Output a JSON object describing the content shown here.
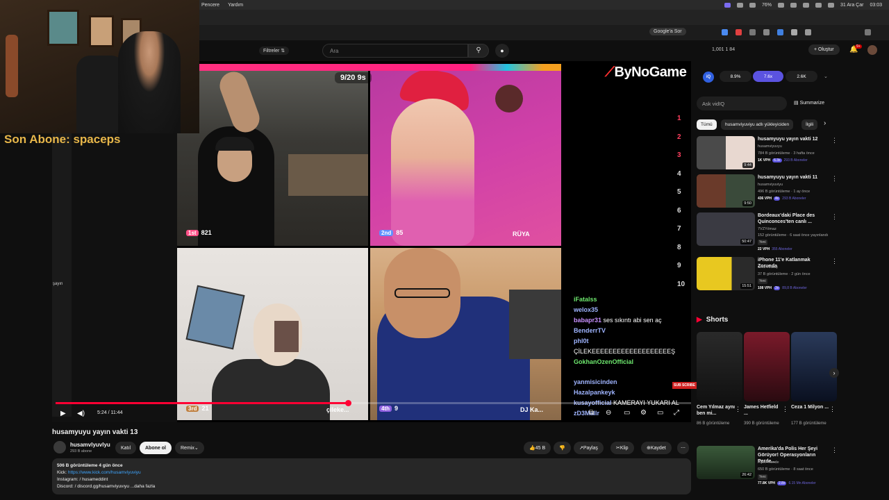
{
  "menubar": {
    "menus": [
      "Pencere",
      "Yardım"
    ],
    "battery": "76%",
    "date": "31 Ara Çar",
    "time": "03:03"
  },
  "browser": {
    "google_sor": "Google'a Sor"
  },
  "stream_overlay": {
    "last_sub": "Son Abone: spaceps"
  },
  "header": {
    "filters": "Filtreler",
    "search_placeholder": "Ara",
    "stats": "1,001  1  84",
    "create": "Oluştur",
    "notif_badge": "9+"
  },
  "player": {
    "timer": "9/20  9s",
    "brand": "ByNoGame",
    "cells": [
      {
        "rank": "1st",
        "score": "821",
        "name": ""
      },
      {
        "rank": "2nd",
        "score": "85",
        "name": "RÜYA"
      },
      {
        "rank": "3rd",
        "score": "21",
        "name": "çileke..."
      },
      {
        "rank": "4th",
        "score": "9",
        "name": "DJ Ka..."
      }
    ],
    "leaderboard": [
      "1",
      "2",
      "3",
      "4",
      "5",
      "6",
      "7",
      "8",
      "9",
      "10"
    ],
    "time": "5:24 / 11:44",
    "progress": 0.46,
    "side_text": "şayın"
  },
  "chat": [
    {
      "user": "iFatalss",
      "msg": ""
    },
    {
      "user": "welox35",
      "msg": ""
    },
    {
      "user": "babapr31",
      "msg": "ses sıkıntı abi sen aç"
    },
    {
      "user": "BenderrTV",
      "msg": ""
    },
    {
      "user": "phl0t",
      "msg": "ÇİLEKEEEEEEEEEEEEEEEEEEEŞ"
    },
    {
      "user": "GokhanOzenOfficial",
      "msg": ""
    },
    {
      "user": "yanmisicinden",
      "msg": ""
    },
    {
      "user": "Hazalpankeyk",
      "msg": ""
    },
    {
      "user": "kusayofficial",
      "msg": "KAMERAYI YUKARI AL"
    },
    {
      "user": "zD3Mallr",
      "msg": ""
    }
  ],
  "chat_badge": "SUB SCRIBE",
  "video": {
    "title": "husamyuyu yayın vakti 13",
    "channel": "husamvlyuvlyu",
    "subs": "293 B abone",
    "join": "Katıl",
    "subscribe": "Abone ol",
    "remix": "Remix",
    "likes": "45 B",
    "share": "Paylaş",
    "clip": "Klip",
    "save": "Kaydet",
    "desc_meta": "506 B görüntüleme  4 gün önce",
    "desc_kick_label": "Kick:",
    "desc_kick_link": "https://www.kick.com/husamviyuviyu",
    "desc_instagram": "Instagram:   / husameddint",
    "desc_discord": "Discord:   / discord.gg/husamviyuvıyu  ...daha fazla"
  },
  "sidebar": {
    "iq_vals": [
      "8.9%",
      "7.6x",
      "2.6K"
    ],
    "iq_label": "iQ",
    "ask": "Ask vidIQ",
    "summarize": "Summarize",
    "chips": [
      "Tümü",
      "husamviyuviyu adlı yükleyiciden",
      "İlgili"
    ],
    "recs": [
      {
        "title": "husamyuyu yayın vakti 12",
        "channel": "husamviyuvyu",
        "views": "784 B görüntüleme · 3 hafta önce",
        "vph": "1K VPH",
        "mult": "6.3x",
        "abo": "293 B Aboneler",
        "dur": "9:44",
        "new": ""
      },
      {
        "title": "husamyuyu yayın vakti 11",
        "channel": "husamviyuviyu",
        "views": "496 B görüntüleme · 1 ay önce",
        "vph": "436 VPH",
        "mult": "4x",
        "abo": "293 B Aboneler",
        "dur": "9:50",
        "new": ""
      },
      {
        "title": "Bordeaux'daki Place des Quinconces'ten canlı ...",
        "channel": "7VZYılmaz",
        "views": "152 görüntüleme · 6 saat önce yayınlandı",
        "vph": "22 VPH",
        "mult": "",
        "abo": "355 Aboneler",
        "dur": "50:47",
        "new": "Yeni"
      },
      {
        "title": "iPhone 11'e Katlanmak Zorunda",
        "channel": "Onur Akbaş",
        "views": "37 B görüntüleme · 2 gün önce",
        "vph": "108 VPH",
        "mult": "3x",
        "abo": "89,8 B Aboneler",
        "dur": "15:51",
        "new": "Yeni"
      }
    ],
    "shorts_title": "Shorts",
    "shorts": [
      {
        "title": "Cem Yılmaz aynı ben mi...",
        "views": "86 B görüntüleme"
      },
      {
        "title": "James Hetfield ...",
        "views": "390 B görüntüleme"
      },
      {
        "title": "Ceza 1 Milyon ...",
        "views": "177 B görüntüleme"
      }
    ],
    "bottom_rec": {
      "title": "Amerika'da Polis Her Şeyi Görüyor! Operasyonların Perde...",
      "channel": "Alper Rende",
      "views": "650 B görüntüleme · 8 saat önce",
      "vph": "77.8K VPH",
      "mult": "2.8x",
      "abo": "6.15 Mn Aboneler",
      "dur": "26:42",
      "new": "Yeni"
    }
  },
  "colors": {
    "accent_red": "#ff0033",
    "brand_pink": "#ff2080",
    "vidiq_purple": "#5b53e0"
  }
}
